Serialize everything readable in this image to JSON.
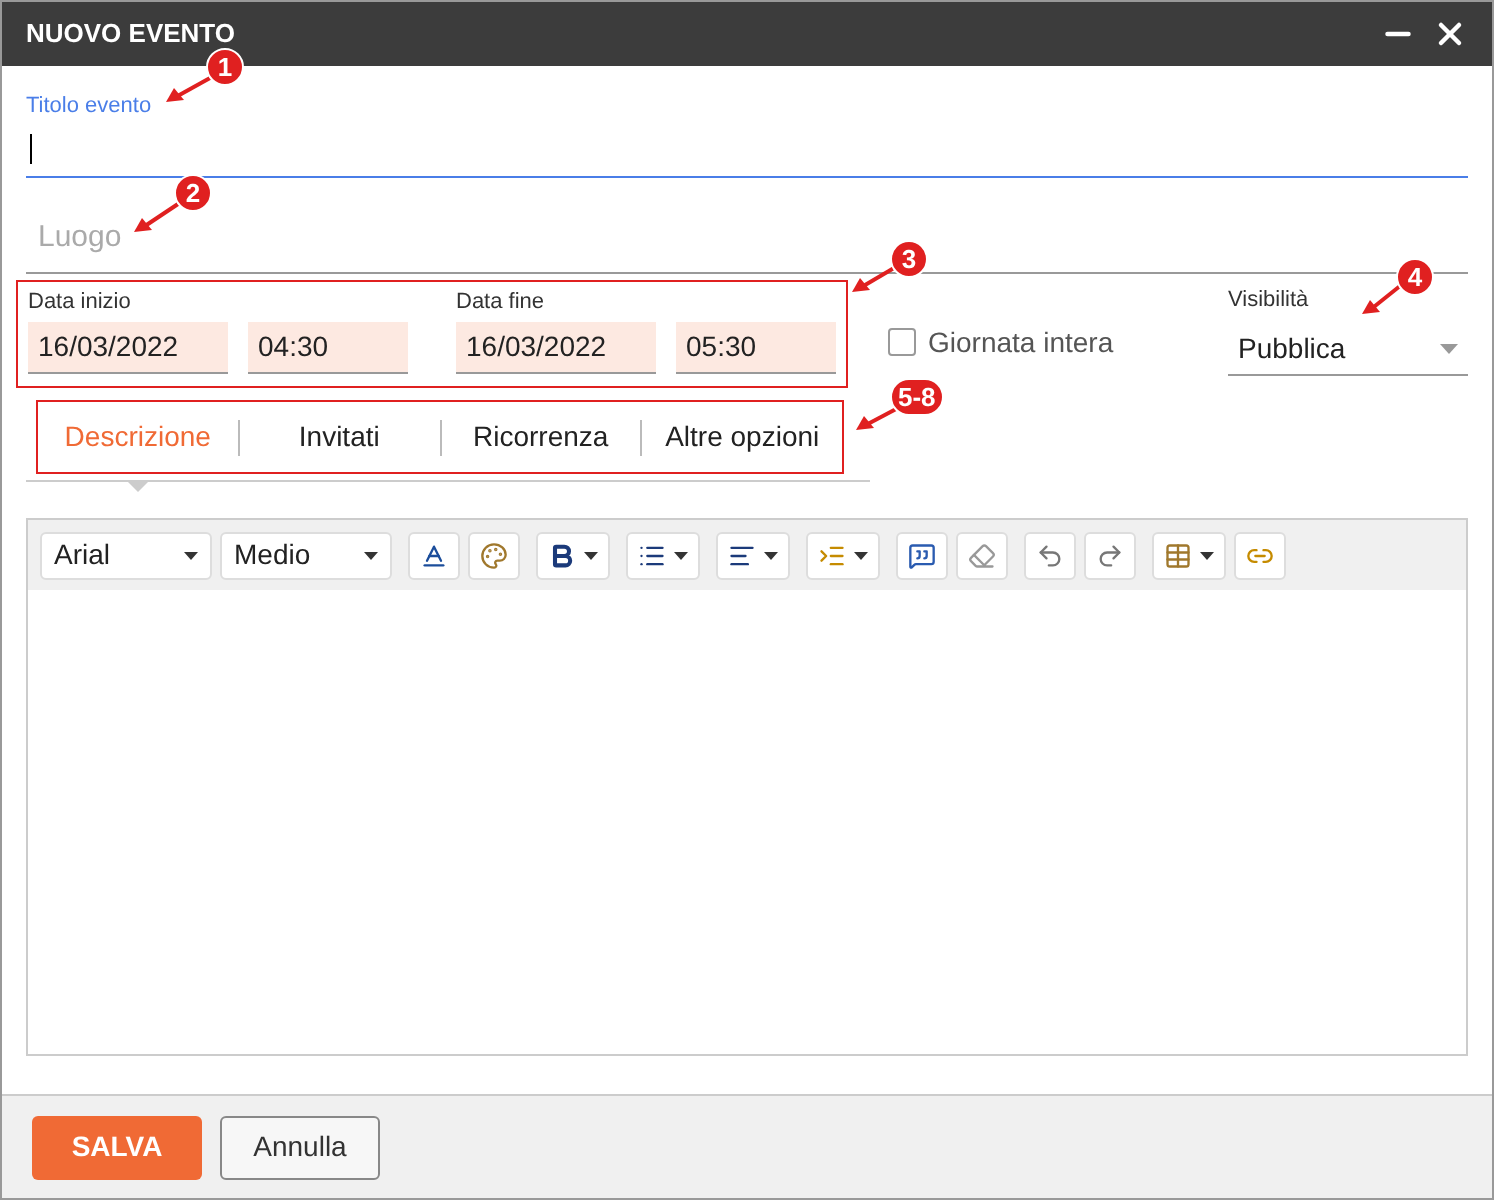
{
  "window": {
    "title": "NUOVO EVENTO"
  },
  "title_field": {
    "label": "Titolo evento",
    "focused": true
  },
  "location_field": {
    "placeholder": "Luogo",
    "focused": false
  },
  "start": {
    "label": "Data inizio",
    "date": "16/03/2022",
    "time": "04:30"
  },
  "end": {
    "label": "Data fine",
    "date": "16/03/2022",
    "time": "05:30"
  },
  "all_day": {
    "label": "Giornata intera",
    "checked": false
  },
  "visibility": {
    "label": "Visibilità",
    "value": "Pubblica"
  },
  "tabs": [
    {
      "label": "Descrizione",
      "selected": true
    },
    {
      "label": "Invitati",
      "selected": false
    },
    {
      "label": "Ricorrenza",
      "selected": false
    },
    {
      "label": "Altre opzioni",
      "selected": false
    }
  ],
  "editor": {
    "font": "Arial",
    "size": "Medio"
  },
  "buttons": {
    "save": "SALVA",
    "cancel": "Annulla"
  },
  "annotations": [
    {
      "label": "1"
    },
    {
      "label": "2"
    },
    {
      "label": "3"
    },
    {
      "label": "4"
    },
    {
      "label": "5-8"
    }
  ]
}
